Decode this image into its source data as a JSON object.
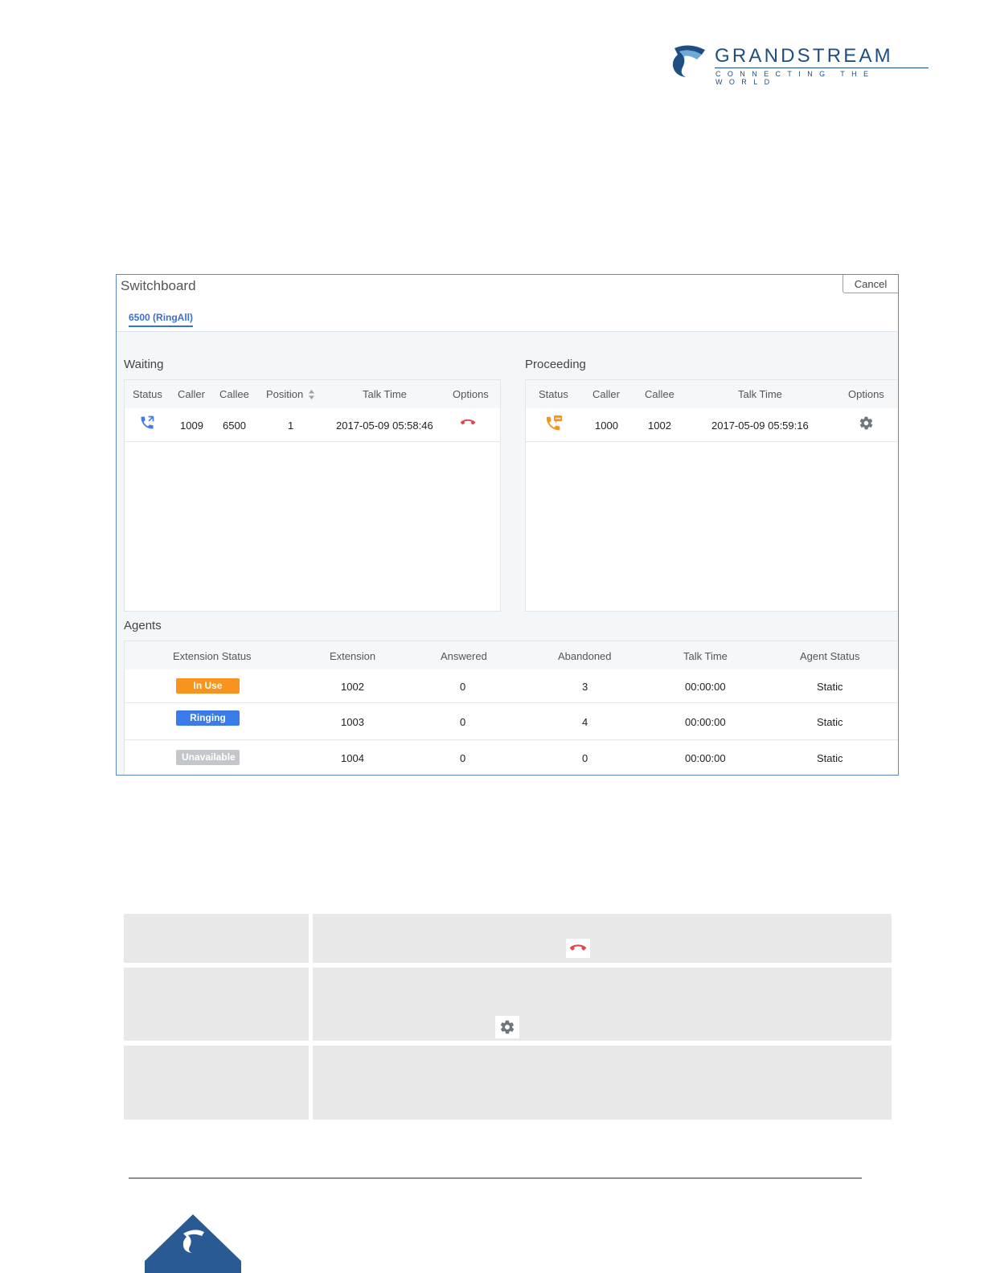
{
  "logo": {
    "brand": "GRANDSTREAM",
    "tagline": "CONNECTING THE WORLD"
  },
  "window": {
    "title": "Switchboard",
    "cancel_label": "Cancel",
    "tab_label": "6500 (RingAll)"
  },
  "waiting": {
    "title": "Waiting",
    "columns": [
      "Status",
      "Caller",
      "Callee",
      "Position",
      "Talk Time",
      "Options"
    ],
    "rows": [
      {
        "status_icon": "incoming-call-icon",
        "caller": "1009",
        "callee": "6500",
        "position": "1",
        "talk_time": "2017-05-09 05:58:46",
        "option_icon": "hangup-icon"
      }
    ]
  },
  "proceeding": {
    "title": "Proceeding",
    "columns": [
      "Status",
      "Caller",
      "Callee",
      "Talk Time",
      "Options"
    ],
    "rows": [
      {
        "status_icon": "talking-call-icon",
        "caller": "1000",
        "callee": "1002",
        "talk_time": "2017-05-09 05:59:16",
        "option_icon": "gear-icon"
      }
    ]
  },
  "agents": {
    "title": "Agents",
    "columns": [
      "Extension Status",
      "Extension",
      "Answered",
      "Abandoned",
      "Talk Time",
      "Agent Status"
    ],
    "rows": [
      {
        "status": "In Use",
        "status_color": "#f7941d",
        "extension": "1002",
        "answered": "0",
        "abandoned": "3",
        "talk_time": "00:00:00",
        "agent_status": "Static"
      },
      {
        "status": "Ringing",
        "status_color": "#3b7bea",
        "extension": "1003",
        "answered": "0",
        "abandoned": "4",
        "talk_time": "00:00:00",
        "agent_status": "Static"
      },
      {
        "status": "Unavailable",
        "status_color": "#c3c6ca",
        "extension": "1004",
        "answered": "0",
        "abandoned": "0",
        "talk_time": "00:00:00",
        "agent_status": "Static"
      }
    ]
  },
  "colors": {
    "accent": "#3b6fd1",
    "brand": "#1f4f82",
    "hangup": "#e0474c",
    "talking": "#f7941d",
    "gear": "#6f767d"
  },
  "description_icons": [
    "hangup-icon",
    "gear-icon"
  ]
}
